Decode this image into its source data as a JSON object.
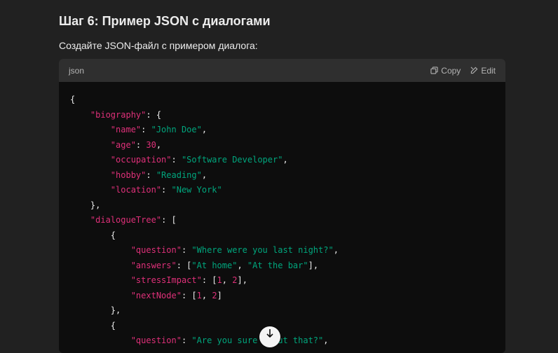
{
  "heading": "Шаг 6: Пример JSON с диалогами",
  "paragraph": "Создайте JSON-файл с примером диалога:",
  "codeblock": {
    "language": "json",
    "copy_label": "Copy",
    "edit_label": "Edit"
  },
  "code_lines": [
    [
      {
        "t": "p",
        "v": "{"
      }
    ],
    [
      {
        "t": "p",
        "v": "    "
      },
      {
        "t": "k",
        "v": "\"biography\""
      },
      {
        "t": "p",
        "v": ": {"
      }
    ],
    [
      {
        "t": "p",
        "v": "        "
      },
      {
        "t": "k",
        "v": "\"name\""
      },
      {
        "t": "p",
        "v": ": "
      },
      {
        "t": "s",
        "v": "\"John Doe\""
      },
      {
        "t": "p",
        "v": ","
      }
    ],
    [
      {
        "t": "p",
        "v": "        "
      },
      {
        "t": "k",
        "v": "\"age\""
      },
      {
        "t": "p",
        "v": ": "
      },
      {
        "t": "n",
        "v": "30"
      },
      {
        "t": "p",
        "v": ","
      }
    ],
    [
      {
        "t": "p",
        "v": "        "
      },
      {
        "t": "k",
        "v": "\"occupation\""
      },
      {
        "t": "p",
        "v": ": "
      },
      {
        "t": "s",
        "v": "\"Software Developer\""
      },
      {
        "t": "p",
        "v": ","
      }
    ],
    [
      {
        "t": "p",
        "v": "        "
      },
      {
        "t": "k",
        "v": "\"hobby\""
      },
      {
        "t": "p",
        "v": ": "
      },
      {
        "t": "s",
        "v": "\"Reading\""
      },
      {
        "t": "p",
        "v": ","
      }
    ],
    [
      {
        "t": "p",
        "v": "        "
      },
      {
        "t": "k",
        "v": "\"location\""
      },
      {
        "t": "p",
        "v": ": "
      },
      {
        "t": "s",
        "v": "\"New York\""
      }
    ],
    [
      {
        "t": "p",
        "v": "    },"
      }
    ],
    [
      {
        "t": "p",
        "v": "    "
      },
      {
        "t": "k",
        "v": "\"dialogueTree\""
      },
      {
        "t": "p",
        "v": ": ["
      }
    ],
    [
      {
        "t": "p",
        "v": "        {"
      }
    ],
    [
      {
        "t": "p",
        "v": "            "
      },
      {
        "t": "k",
        "v": "\"question\""
      },
      {
        "t": "p",
        "v": ": "
      },
      {
        "t": "s",
        "v": "\"Where were you last night?\""
      },
      {
        "t": "p",
        "v": ","
      }
    ],
    [
      {
        "t": "p",
        "v": "            "
      },
      {
        "t": "k",
        "v": "\"answers\""
      },
      {
        "t": "p",
        "v": ": ["
      },
      {
        "t": "s",
        "v": "\"At home\""
      },
      {
        "t": "p",
        "v": ", "
      },
      {
        "t": "s",
        "v": "\"At the bar\""
      },
      {
        "t": "p",
        "v": "],"
      }
    ],
    [
      {
        "t": "p",
        "v": "            "
      },
      {
        "t": "k",
        "v": "\"stressImpact\""
      },
      {
        "t": "p",
        "v": ": ["
      },
      {
        "t": "n",
        "v": "1"
      },
      {
        "t": "p",
        "v": ", "
      },
      {
        "t": "n",
        "v": "2"
      },
      {
        "t": "p",
        "v": "],"
      }
    ],
    [
      {
        "t": "p",
        "v": "            "
      },
      {
        "t": "k",
        "v": "\"nextNode\""
      },
      {
        "t": "p",
        "v": ": ["
      },
      {
        "t": "n",
        "v": "1"
      },
      {
        "t": "p",
        "v": ", "
      },
      {
        "t": "n",
        "v": "2"
      },
      {
        "t": "p",
        "v": "]"
      }
    ],
    [
      {
        "t": "p",
        "v": "        },"
      }
    ],
    [
      {
        "t": "p",
        "v": "        {"
      }
    ],
    [
      {
        "t": "p",
        "v": "            "
      },
      {
        "t": "k",
        "v": "\"question\""
      },
      {
        "t": "p",
        "v": ": "
      },
      {
        "t": "s",
        "v": "\"Are you sure about that?\""
      },
      {
        "t": "p",
        "v": ","
      }
    ]
  ],
  "colors": {
    "background": "#212121",
    "code_bg": "#0d0d0d",
    "header_bg": "#2f2f2f",
    "key": "#df3079",
    "string": "#00a67d"
  },
  "icons": {
    "copy": "copy-icon",
    "edit": "edit-icon",
    "scroll": "arrow-down-icon"
  }
}
